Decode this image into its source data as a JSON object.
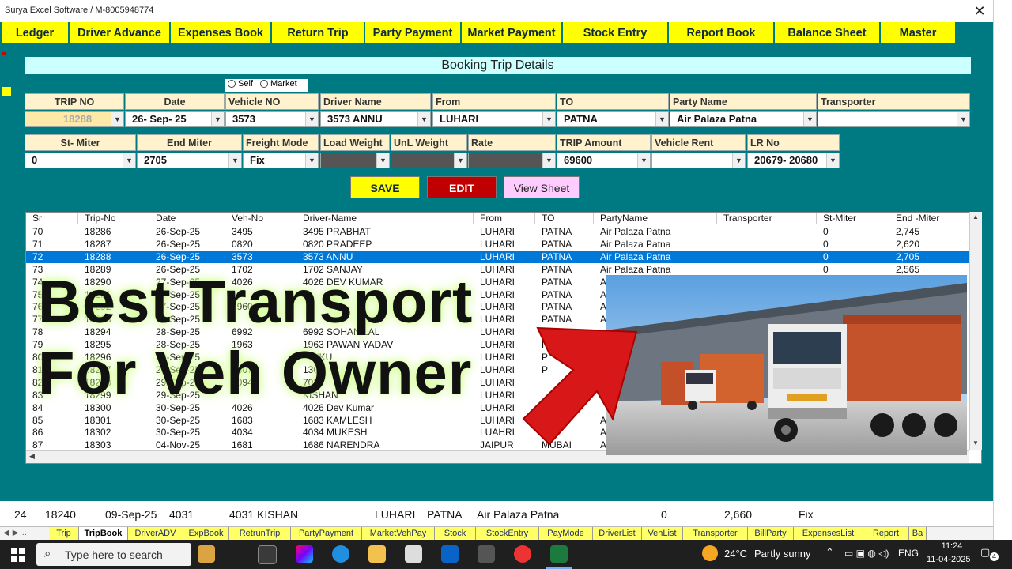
{
  "window": {
    "title": "Surya Excel Software / M-8005948774",
    "close": "✕"
  },
  "menu": [
    {
      "label": "Ledger",
      "w": 86
    },
    {
      "label": "Driver Advance",
      "w": 128
    },
    {
      "label": "Expenses Book",
      "w": 128
    },
    {
      "label": "Return Trip",
      "w": 118
    },
    {
      "label": "Party Payment",
      "w": 122
    },
    {
      "label": "Market Payment",
      "w": 128
    },
    {
      "label": "Stock Entry",
      "w": 134
    },
    {
      "label": "Report Book",
      "w": 134
    },
    {
      "label": "Balance Sheet",
      "w": 134
    },
    {
      "label": "Master",
      "w": 96
    }
  ],
  "form": {
    "title": "Booking Trip Details",
    "radio_self": "Self",
    "radio_market": "Market",
    "labels1": [
      "TRIP NO",
      "Date",
      "Vehicle NO",
      "Driver Name",
      "From",
      "TO",
      "Party Name",
      "Transporter"
    ],
    "values1": [
      "18288",
      "26- Sep- 25",
      "3573",
      "3573 ANNU",
      "LUHARI",
      "PATNA",
      "Air Palaza Patna",
      ""
    ],
    "labels2": [
      "St- Miter",
      "End Miter",
      "Freight Mode",
      "Load Weight",
      "UnL Weight",
      "Rate",
      "TRIP Amount",
      "Vehicle Rent",
      "LR No"
    ],
    "values2": [
      "0",
      "2705",
      "Fix",
      "",
      "",
      "",
      "69600",
      "",
      "20679- 20680"
    ],
    "save": "SAVE",
    "edit": "EDIT",
    "view": "View Sheet"
  },
  "grid": {
    "headers": [
      "Sr",
      "Trip-No",
      "Date",
      "Veh-No",
      "Driver-Name",
      "From",
      "TO",
      "PartyName",
      "Transporter",
      "St-Miter",
      "End -Miter"
    ],
    "rows": [
      [
        "70",
        "18286",
        "26-Sep-25",
        "3495",
        "3495 PRABHAT",
        "LUHARI",
        "PATNA",
        "Air Palaza Patna",
        "",
        "0",
        "2,745"
      ],
      [
        "71",
        "18287",
        "26-Sep-25",
        "0820",
        "0820 PRADEEP",
        "LUHARI",
        "PATNA",
        "Air Palaza Patna",
        "",
        "0",
        "2,620"
      ],
      [
        "72",
        "18288",
        "26-Sep-25",
        "3573",
        "3573 ANNU",
        "LUHARI",
        "PATNA",
        "Air Palaza Patna",
        "",
        "0",
        "2,705"
      ],
      [
        "73",
        "18289",
        "26-Sep-25",
        "1702",
        "1702 SANJAY",
        "LUHARI",
        "PATNA",
        "Air Palaza Patna",
        "",
        "0",
        "2,565"
      ],
      [
        "74",
        "18290",
        "27-Sep-25",
        "4026",
        "4026 DEV KUMAR",
        "LUHARI",
        "PATNA",
        "A",
        "",
        "",
        ""
      ],
      [
        "75",
        "18291",
        "27-Sep-25",
        "",
        "",
        "LUHARI",
        "PATNA",
        "A",
        "",
        "",
        ""
      ],
      [
        "76",
        "18292",
        "27-Sep-25",
        "1960",
        "",
        "LUHARI",
        "PATNA",
        "A",
        "",
        "",
        ""
      ],
      [
        "77",
        "18293",
        "28-Sep-25",
        "",
        "",
        "LUHARI",
        "PATNA",
        "A",
        "",
        "",
        ""
      ],
      [
        "78",
        "18294",
        "28-Sep-25",
        "6992",
        "6992 SOHAN LAL",
        "LUHARI",
        "",
        "",
        "",
        "",
        ""
      ],
      [
        "79",
        "18295",
        "28-Sep-25",
        "1963",
        "1963 PAWAN YADAV",
        "LUHARI",
        "PAT",
        "",
        "",
        "",
        ""
      ],
      [
        "80",
        "18296",
        "29-Sep-25",
        "",
        "RINKU",
        "LUHARI",
        "P",
        "",
        "",
        "",
        ""
      ],
      [
        "81",
        "18297",
        "29-Sep-25",
        "1307",
        "1307",
        "LUHARI",
        "P",
        "",
        "",
        "",
        ""
      ],
      [
        "82",
        "18298",
        "29-Sep-25",
        "7094",
        "7094",
        "LUHARI",
        "",
        "",
        "",
        "",
        ""
      ],
      [
        "83",
        "18299",
        "29-Sep-25",
        "",
        "KISHAN",
        "LUHARI",
        "",
        "",
        "",
        "",
        ""
      ],
      [
        "84",
        "18300",
        "30-Sep-25",
        "4026",
        "4026 Dev Kumar",
        "LUHARI",
        "",
        "",
        "",
        "",
        ""
      ],
      [
        "85",
        "18301",
        "30-Sep-25",
        "1683",
        "1683 KAMLESH",
        "LUHARI",
        "",
        "A",
        "",
        "",
        ""
      ],
      [
        "86",
        "18302",
        "30-Sep-25",
        "4034",
        "4034 MUKESH",
        "LUAHRI",
        "PAT",
        "A",
        "",
        "",
        ""
      ],
      [
        "87",
        "18303",
        "04-Nov-25",
        "1681",
        "1686 NARENDRA",
        "JAIPUR",
        "MUBAI",
        "A",
        "",
        "",
        ""
      ]
    ],
    "selected_index": 2
  },
  "overlay": {
    "line1": "Best Transport",
    "line2": "For Veh Owner"
  },
  "bottom_row": {
    "sr": "24",
    "trip": "18240",
    "date": "09-Sep-25",
    "veh": "4031",
    "driver": "4031 KISHAN",
    "from": "LUHARI",
    "to": "PATNA",
    "party": "Air Palaza Patna",
    "st": "0",
    "end": "2,660",
    "mode": "Fix"
  },
  "sheet_tabs": [
    "Trip",
    "TripBook",
    "DriverADV",
    "ExpBook",
    "RetrunTrip",
    "PartyPayment",
    "MarketVehPay",
    "Stock",
    "StockEntry",
    "PayMode",
    "DriverList",
    "VehList",
    "Transporter",
    "BillParty",
    "ExpensesList",
    "Report",
    "Ba"
  ],
  "sheet_active": 1,
  "taskbar": {
    "search": "Type here to search",
    "temp": "24°C",
    "weather": "Partly sunny",
    "lang": "ENG",
    "time": "11:24",
    "date": "11-04-2025",
    "notif": "4"
  },
  "colors": {
    "teal": "#007a82",
    "menu_yellow": "#ffff00",
    "select_blue": "#0078d7",
    "edit_red": "#c00000",
    "view_pink": "#ffccff"
  }
}
